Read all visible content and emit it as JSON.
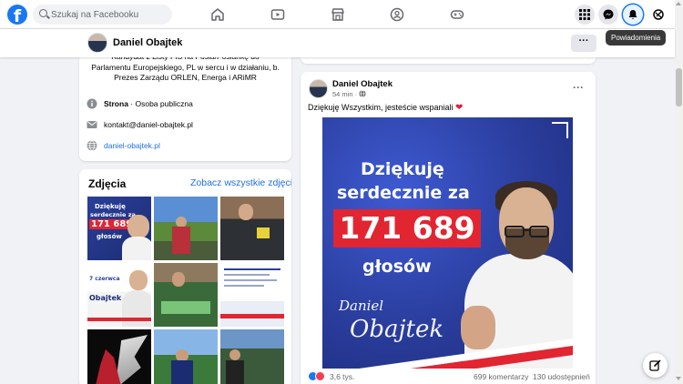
{
  "header": {
    "logo_letter": "f",
    "search_placeholder": "Szukaj na Facebooku",
    "nav_icons": [
      "home-icon",
      "video-icon",
      "marketplace-icon",
      "groups-icon",
      "gaming-icon"
    ],
    "right_buttons": [
      "menu-grid-icon",
      "messenger-icon",
      "notifications-icon",
      "account-icon"
    ],
    "tooltip": "Powiadomienia",
    "accent_color": "#1877f2"
  },
  "profile_bar": {
    "name": "Daniel Obajtek",
    "more_label": "···"
  },
  "intro": {
    "bio_line1": "Kandydat z Listy PiS na Posła/Posłankę do",
    "bio_line2": "Parlamentu Europejskiego, PL w sercu i w działaniu, b.",
    "bio_line3": "Prezes Zarządu ORLEN, Energa i ARiMR",
    "page_type_bold": "Strona",
    "page_type_rest": " · Osoba publiczna",
    "email": "kontakt@daniel-obajtek.pl",
    "website": "daniel-obajtek.pl"
  },
  "photos": {
    "title": "Zdjęcia",
    "see_all": "Zobacz wszystkie zdjęcia",
    "thumb1_line1": "Dziękuję",
    "thumb1_line2": "serdecznie za",
    "thumb1_num": "171 689",
    "thumb1_line3": "głosów",
    "thumb4_line1": "7 czerwca",
    "thumb4_name": "Obajtek"
  },
  "post": {
    "author": "Daniel Obajtek",
    "time": "54 min ·",
    "text": "Dziękuję Wszystkim, jesteście wspaniali ",
    "heart": "❤",
    "more_label": "···",
    "image": {
      "line1": "Dziękuję",
      "line2": "serdecznie za",
      "number": "171 689",
      "line3": "głosów",
      "signature_first": "Daniel",
      "signature_last": "Obajtek"
    },
    "reactions_count": "3,6 tys.",
    "comments": "699 komentarzy",
    "shares": "130 udostępnień"
  }
}
